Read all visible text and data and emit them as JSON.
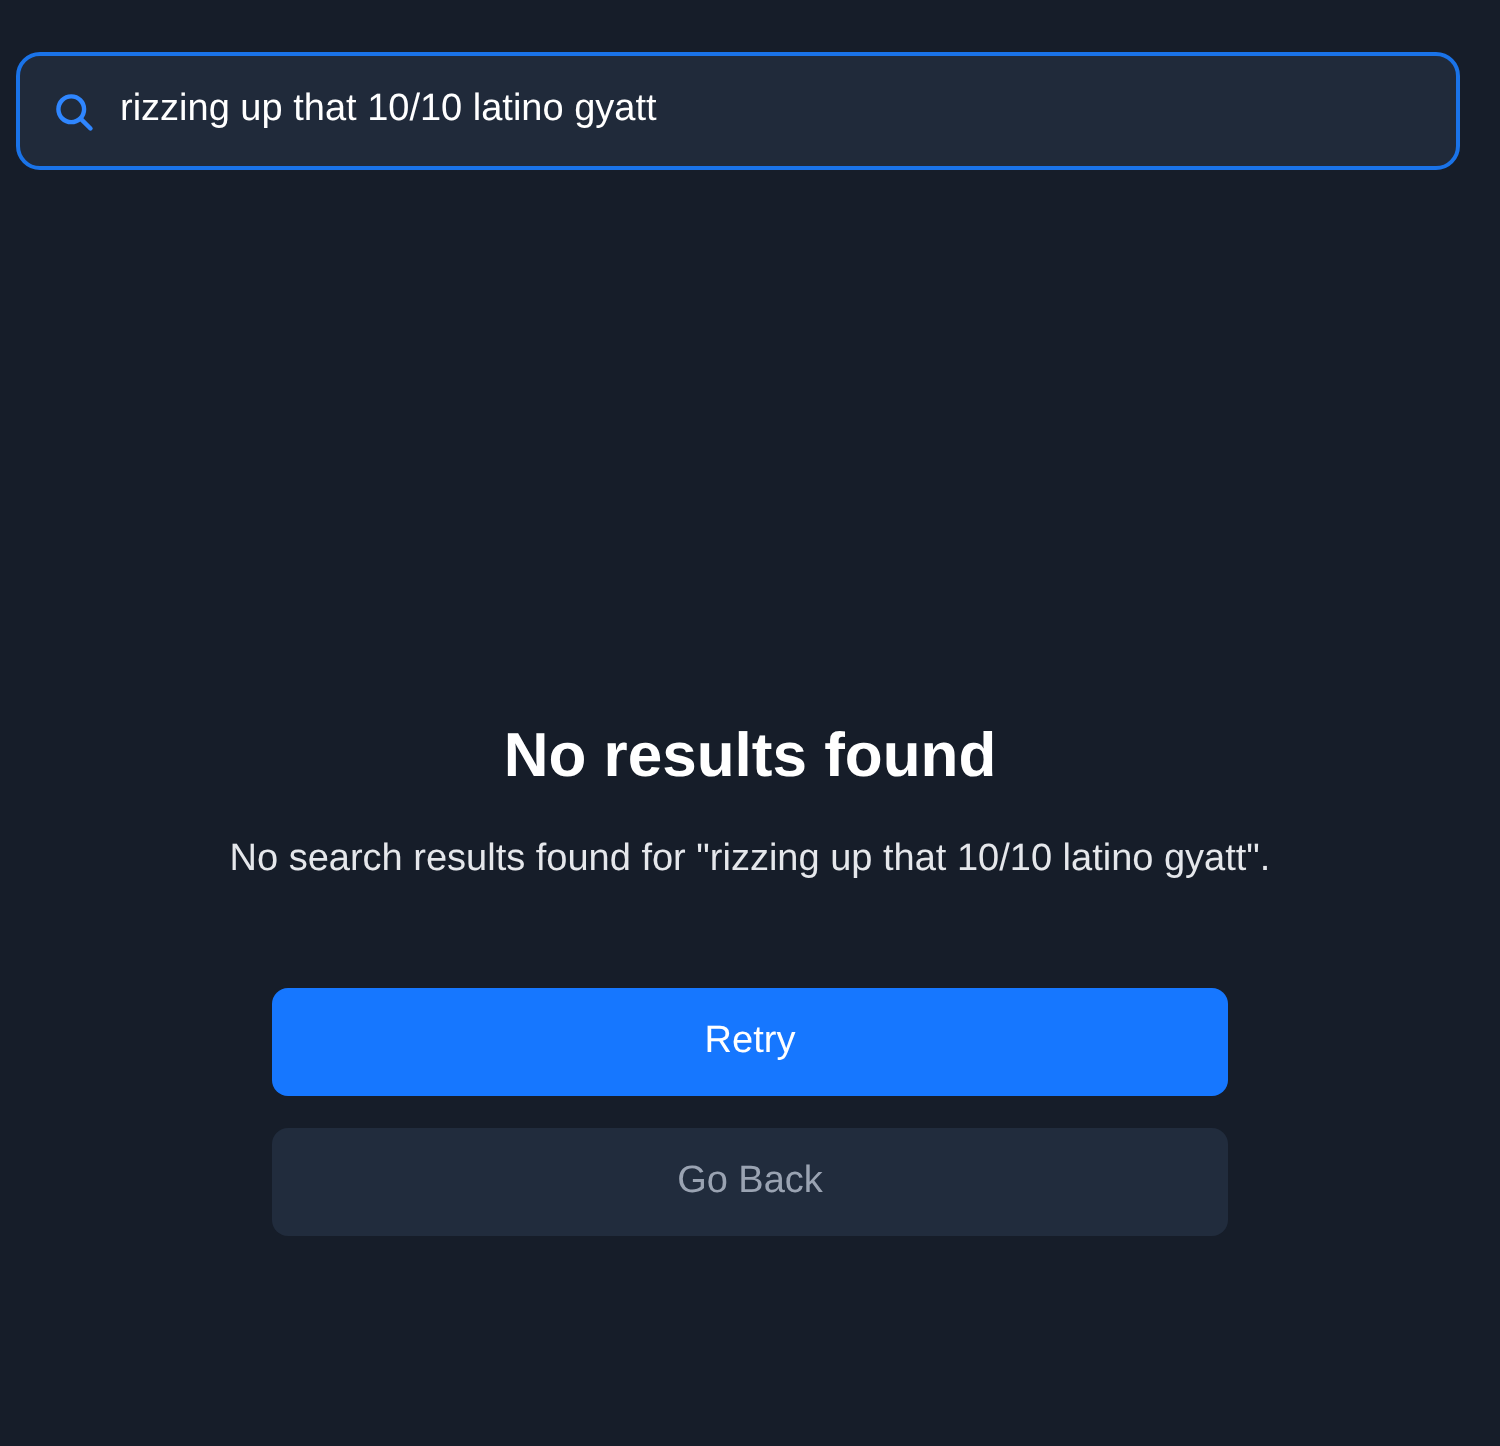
{
  "search": {
    "value": "rizzing up that 10/10 latino gyatt",
    "focused": true
  },
  "empty_state": {
    "title": "No results found",
    "message": "No search results found for \"rizzing up that 10/10 latino gyatt\"."
  },
  "buttons": [
    {
      "label": "Retry",
      "kind": "primary"
    },
    {
      "label": "Go Back",
      "kind": "secondary"
    }
  ]
}
